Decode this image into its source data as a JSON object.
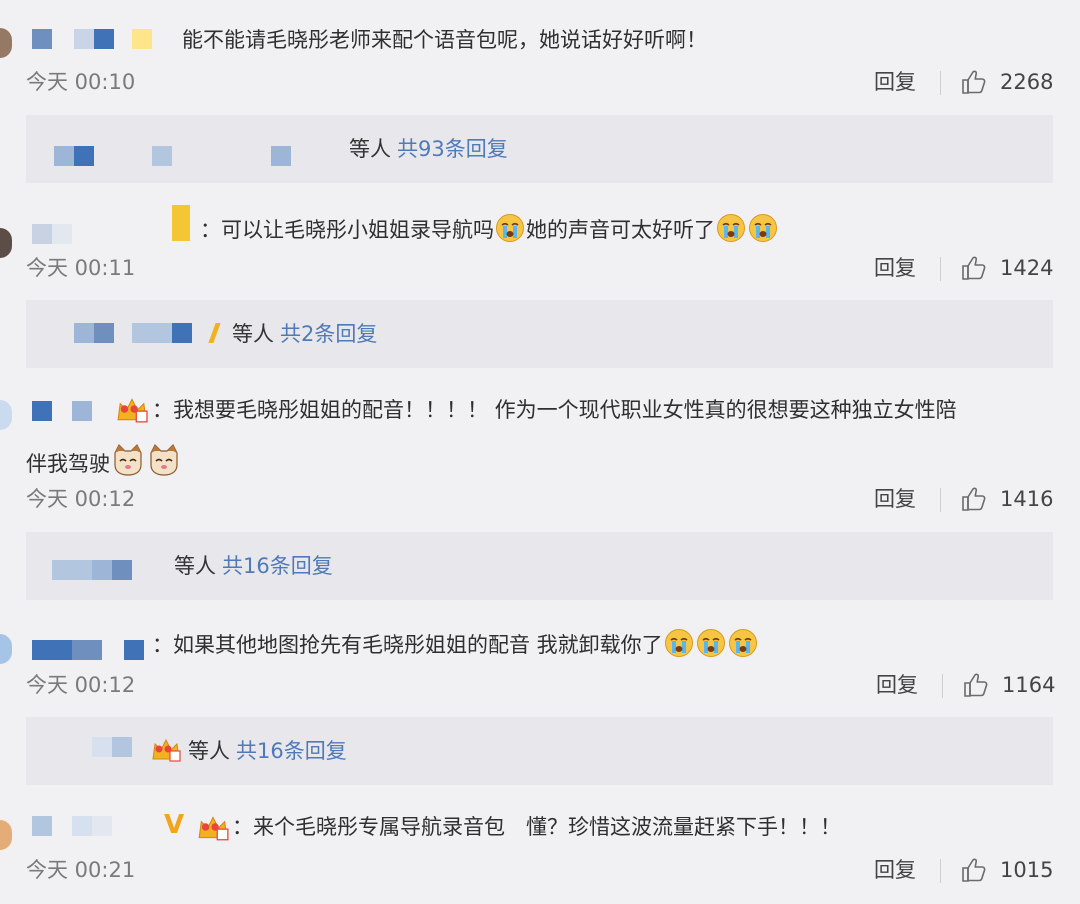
{
  "colors": {
    "background": "#f1f1f4",
    "reply_box": "#e8e8ec",
    "link": "#4f7ab7",
    "meta": "#7a7a7a",
    "mosaic_dark": "#3f72b6",
    "mosaic_light": "#9db6d8"
  },
  "icons": {
    "like": "thumbs-up-icon",
    "crying_emoji": "crying-face-icon",
    "cat_emoji": "cat-face-icon",
    "vip_badge": "crown-badge-icon"
  },
  "comments": [
    {
      "text": "能不能请毛晓彤老师来配个语音包呢，她说话好好听啊！",
      "time": "今天 00:10",
      "reply_label": "回复",
      "likes": "2268",
      "reply_summary": {
        "suffix": "等人",
        "link": "共93条回复"
      }
    },
    {
      "text_prefix": "：可以让毛晓彤小姐姐录导航吗",
      "text_middle": "她的声音可太好听了",
      "time": "今天 00:11",
      "reply_label": "回复",
      "likes": "1424",
      "reply_summary": {
        "suffix": "等人",
        "link": "共2条回复"
      }
    },
    {
      "text": "：我想要毛晓彤姐姐的配音！！！！ 作为一个现代职业女性真的很想要这种独立女性陪",
      "text_line2": "伴我驾驶",
      "time": "今天 00:12",
      "reply_label": "回复",
      "likes": "1416",
      "reply_summary": {
        "suffix": "等人",
        "link": "共16条回复"
      }
    },
    {
      "text": "：如果其他地图抢先有毛晓彤姐姐的配音 我就卸载你了",
      "time": "今天 00:12",
      "reply_label": "回复",
      "likes": "1164",
      "reply_summary": {
        "suffix": "等人",
        "link": "共16条回复"
      }
    },
    {
      "text": "：来个毛晓彤专属导航录音包　懂？珍惜这波流量赶紧下手！！！",
      "time": "今天 00:21",
      "reply_label": "回复",
      "likes": "1015"
    }
  ]
}
